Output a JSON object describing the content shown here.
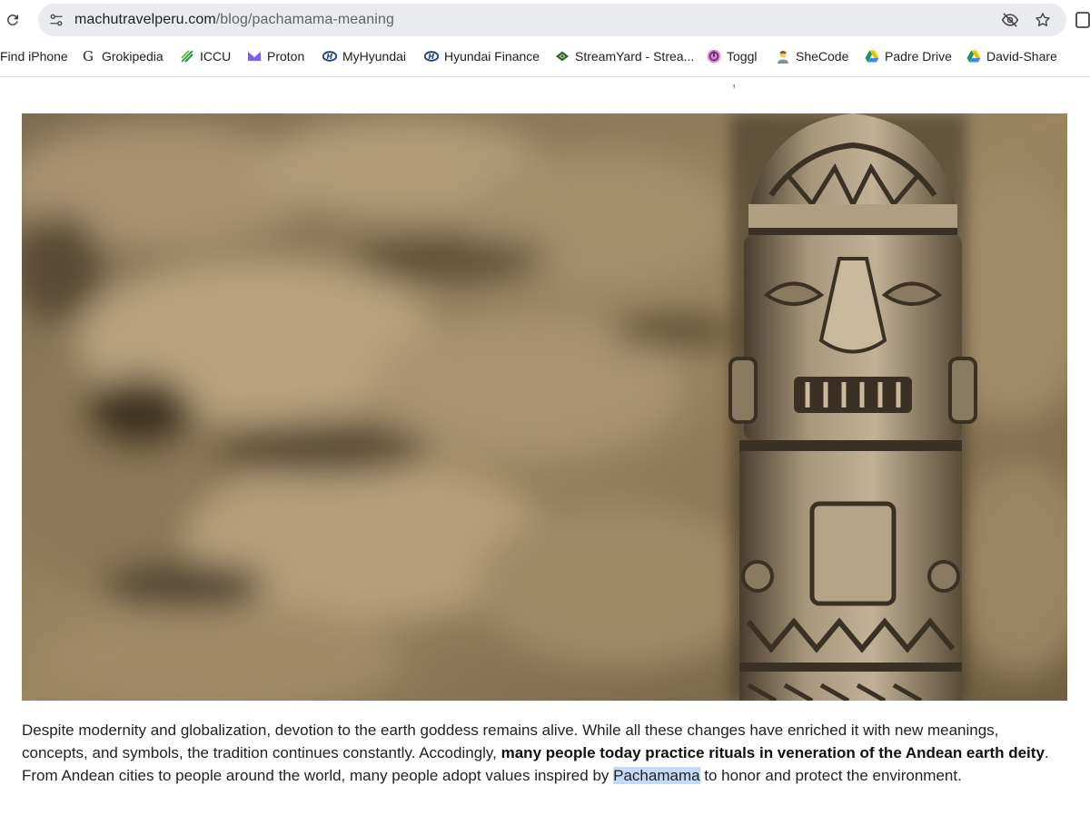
{
  "browser": {
    "url_host": "machutravelperu.com",
    "url_path": "/blog/pachamama-meaning"
  },
  "bookmarks": [
    {
      "label": "Find iPhone",
      "icon": "apple-icon"
    },
    {
      "label": "Grokipedia",
      "icon": "grokipedia-icon"
    },
    {
      "label": "ICCU",
      "icon": "iccu-icon"
    },
    {
      "label": "Proton",
      "icon": "proton-icon"
    },
    {
      "label": "MyHyundai",
      "icon": "hyundai-icon"
    },
    {
      "label": "Hyundai Finance",
      "icon": "hyundai-icon"
    },
    {
      "label": "StreamYard - Strea...",
      "icon": "streamyard-icon"
    },
    {
      "label": "Toggl",
      "icon": "toggl-icon"
    },
    {
      "label": "SheCode",
      "icon": "shecode-icon"
    },
    {
      "label": "Padre Drive",
      "icon": "google-drive-icon"
    },
    {
      "label": "David-Share",
      "icon": "google-drive-icon"
    }
  ],
  "article": {
    "cut_off_text": ",",
    "paragraph": {
      "part1": "Despite modernity and globalization, devotion to the earth goddess remains alive. While all these changes have enriched it with new meanings, concepts, and symbols, the tradition continues constantly. Accodingly, ",
      "bold": "many people today practice rituals in veneration of the Andean earth deity",
      "part2": ". From Andean cities to people around the world, many people adopt values inspired by ",
      "highlight": "Pachamama",
      "part3": " to honor and protect the environment."
    }
  },
  "colors": {
    "omnibox_bg": "#e9ebee",
    "selection": "#c5daf7",
    "text": "#222222",
    "url_path": "#5f6368"
  }
}
